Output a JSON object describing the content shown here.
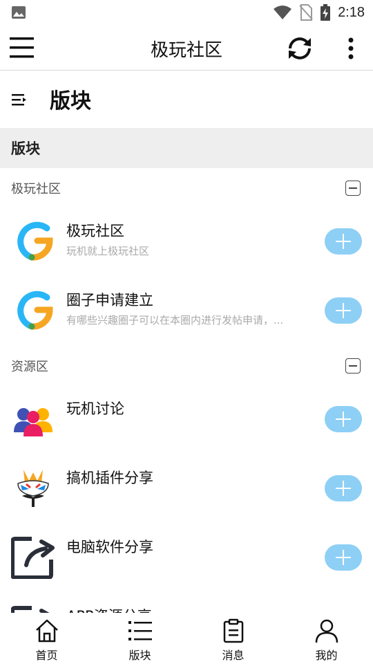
{
  "status_bar": {
    "time": "2:18"
  },
  "app_bar": {
    "title": "极玩社区"
  },
  "section": {
    "title": "版块"
  },
  "group_bar": {
    "title": "版块"
  },
  "categories": [
    {
      "title": "极玩社区",
      "items": [
        {
          "name": "极玩社区",
          "desc": "玩机就上极玩社区",
          "logo": "g-logo"
        },
        {
          "name": "圈子申请建立",
          "desc": "有哪些兴趣圈子可以在本圈内进行发帖申请，...",
          "logo": "g-logo"
        }
      ]
    },
    {
      "title": "资源区",
      "items": [
        {
          "name": "玩机讨论",
          "desc": "",
          "logo": "people-group-icon"
        },
        {
          "name": "搞机插件分享",
          "desc": "",
          "logo": "opera-mask-icon"
        },
        {
          "name": "电脑软件分享",
          "desc": "",
          "logo": "share-arrow-icon"
        },
        {
          "name": "APP资源分享",
          "desc": "",
          "logo": "share-arrow-icon"
        }
      ]
    }
  ],
  "bottom_nav": [
    {
      "label": "首页",
      "icon": "home-icon"
    },
    {
      "label": "版块",
      "icon": "list-icon"
    },
    {
      "label": "消息",
      "icon": "clipboard-icon"
    },
    {
      "label": "我的",
      "icon": "person-icon"
    }
  ],
  "colors": {
    "accent": "#8ecff5",
    "brand_blue": "#29b6f6",
    "brand_orange": "#f5a623"
  }
}
